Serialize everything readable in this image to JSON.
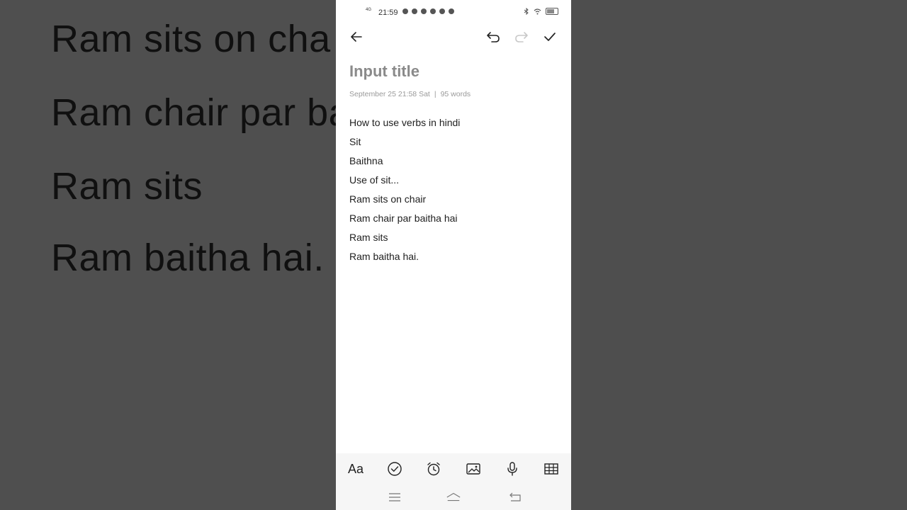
{
  "background": {
    "lines": [
      "Ram sits on cha",
      "Ram chair par ba",
      "Ram sits",
      "Ram baitha hai."
    ]
  },
  "status_bar": {
    "network": "4G",
    "time": "21:59",
    "battery_icon": "battery-icon"
  },
  "toolbar": {
    "back_icon": "arrow-left-icon",
    "undo_icon": "undo-icon",
    "redo_icon": "redo-icon",
    "done_icon": "check-icon"
  },
  "note": {
    "title_placeholder": "Input title",
    "date": "September 25 21:58 Sat",
    "separator": "|",
    "word_count": "95 words",
    "lines": [
      "How to use verbs in hindi",
      "Sit",
      "Baithna",
      "Use of sit...",
      "Ram sits on chair",
      "Ram chair par baitha hai",
      "Ram sits",
      "Ram baitha hai."
    ]
  },
  "format_bar": {
    "text_style_label": "Aa",
    "icons": [
      "text-style-icon",
      "checklist-icon",
      "alarm-icon",
      "image-icon",
      "microphone-icon",
      "table-icon"
    ]
  },
  "nav_bar": {
    "icons": [
      "menu-icon",
      "home-icon",
      "back-nav-icon"
    ]
  },
  "colors": {
    "backdrop": "#4e4e4e",
    "title_placeholder": "#8a8a8a",
    "body_text": "#1e1e1e",
    "meta_text": "#9a9a9a",
    "redo_disabled": "#c8c8c8"
  }
}
